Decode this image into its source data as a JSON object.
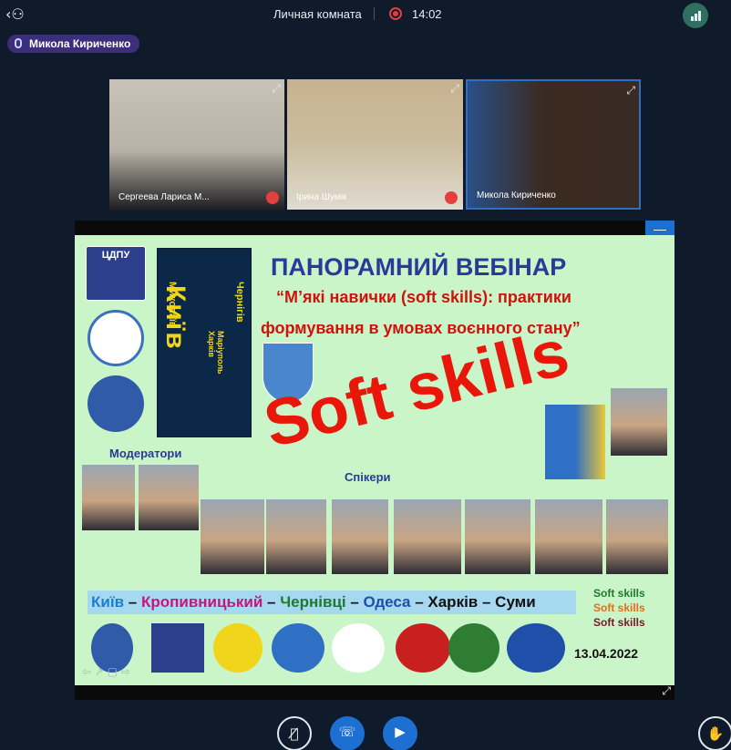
{
  "header": {
    "back_icon": "back-icon",
    "room_title": "Личная комната",
    "time": "14:02",
    "signal_icon": "signal-bars-icon"
  },
  "active_speaker": {
    "name": "Микола Кириченко"
  },
  "participants": [
    {
      "name": "Сергеева Лариса М...",
      "muted": true
    },
    {
      "name": "Ірина Шумік",
      "muted": true
    },
    {
      "name": "Микола Кириченко",
      "muted": false,
      "active": true
    }
  ],
  "slide": {
    "title": "ПАНОРАМНИЙ ВЕБІНАР",
    "subtitle_line1": "“М’які навички (soft skills): практики",
    "subtitle_line2": "формування в умовах воєнного стану”",
    "big_text": "Soft skills",
    "logo_text": "ЦДПУ",
    "banner_center": "Київ",
    "banner_left": "Миколаїв",
    "banner_right": "Чернігів",
    "banner_bottom": "Маріуполь Харків",
    "moderators_label": "Модератори",
    "speakers_label": "Спікери",
    "cities": [
      {
        "text": "Київ",
        "color": "#1a7fd1"
      },
      {
        "text": " – ",
        "color": "#111111"
      },
      {
        "text": "Кропивницький",
        "color": "#c8157e"
      },
      {
        "text": " – ",
        "color": "#111111"
      },
      {
        "text": "Чернівці",
        "color": "#1f7a2e"
      },
      {
        "text": " – ",
        "color": "#111111"
      },
      {
        "text": "Одеса",
        "color": "#1f4fa8"
      },
      {
        "text": " – ",
        "color": "#111111"
      },
      {
        "text": "Харків",
        "color": "#111111"
      },
      {
        "text": " – ",
        "color": "#111111"
      },
      {
        "text": "Суми",
        "color": "#111111"
      }
    ],
    "soft_list": [
      {
        "text": "Soft skills",
        "color": "#1f7a2e"
      },
      {
        "text": "Soft skills",
        "color": "#e0701a"
      },
      {
        "text": "Soft skills",
        "color": "#7a1a2a"
      }
    ],
    "date": "13.04.2022"
  },
  "controls": {
    "mic_icon": "microphone-off-icon",
    "phone_icon": "phone-icon",
    "camera_icon": "camera-icon",
    "hand_icon": "raise-hand-icon"
  }
}
